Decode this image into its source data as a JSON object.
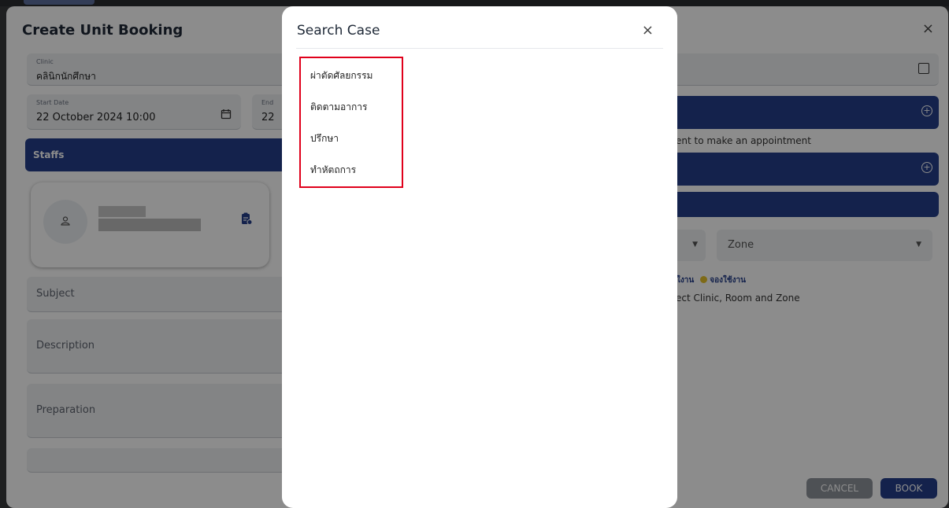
{
  "booking_dialog": {
    "title": "Create Unit Booking",
    "close": "×",
    "clinic_label": "Clinic",
    "clinic_value": "คลินิกนักศึกษา",
    "start_date_label": "Start Date",
    "start_date_value": "22 October 2024 10:00",
    "end_date_label": "End",
    "end_date_value": "22",
    "staffs_label": "Staffs",
    "subject_placeholder": "Subject",
    "description_placeholder": "Description",
    "preparation_placeholder": "Preparation",
    "patient_hint": "tient to make an appointment",
    "zone_placeholder": "Zone",
    "legend_available": "ใงาน",
    "legend_booked": "จองใช้งาน",
    "select_hint": "ect Clinic, Room and Zone",
    "cancel_label": "CANCEL",
    "book_label": "BOOK"
  },
  "search_case": {
    "title": "Search Case",
    "close": "×",
    "items": [
      {
        "label": "ผ่าตัดศัลยกรรม"
      },
      {
        "label": "ติดตามอาการ"
      },
      {
        "label": "ปรึกษา"
      },
      {
        "label": "ทำหัตถการ"
      }
    ]
  },
  "colors": {
    "primary": "#253f8a",
    "highlight_border": "#e0001b",
    "booked_dot": "#e6c12a"
  }
}
